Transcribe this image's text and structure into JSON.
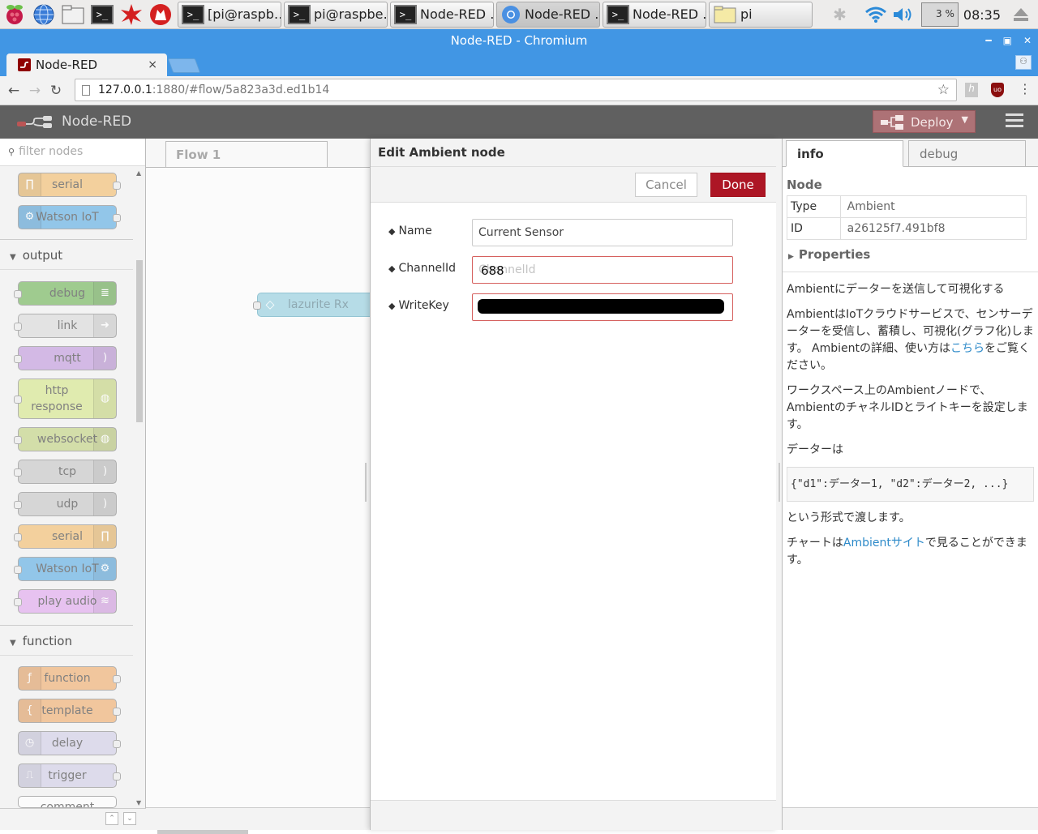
{
  "taskbar": {
    "tasks": [
      {
        "label": "[pi@raspb…"
      },
      {
        "label": "pi@raspbe…"
      },
      {
        "label": "Node-RED …"
      },
      {
        "label": "Node-RED …"
      },
      {
        "label": "Node-RED …"
      },
      {
        "label": "pi"
      }
    ],
    "cpu": "3 %",
    "clock": "08:35"
  },
  "browser": {
    "window_title": "Node-RED - Chromium",
    "tab_title": "Node-RED",
    "url_host": "127.0.0.1",
    "url_rest": ":1880/#flow/5a823a3d.ed1b14"
  },
  "header": {
    "app_name": "Node-RED",
    "deploy_label": "Deploy"
  },
  "palette": {
    "filter_placeholder": "filter nodes",
    "top_nodes": [
      "serial",
      "Watson IoT"
    ],
    "categories": [
      {
        "label": "output",
        "nodes": [
          "debug",
          "link",
          "mqtt",
          "http response",
          "websocket",
          "tcp",
          "udp",
          "serial",
          "Watson IoT",
          "play audio"
        ]
      },
      {
        "label": "function",
        "nodes": [
          "function",
          "template",
          "delay",
          "trigger",
          "comment"
        ]
      }
    ]
  },
  "workspace": {
    "flow_tab": "Flow 1",
    "node_label": "lazurite Rx"
  },
  "edit": {
    "title": "Edit Ambient node",
    "cancel": "Cancel",
    "done": "Done",
    "fields": [
      {
        "label": "Name",
        "value": "Current Sensor",
        "placeholder": ""
      },
      {
        "label": "ChannelId",
        "value": "688",
        "placeholder": "ChannelId"
      },
      {
        "label": "WriteKey",
        "value": "",
        "placeholder": ""
      }
    ]
  },
  "sidebar": {
    "tabs": [
      "info",
      "debug"
    ],
    "node_header": "Node",
    "rows": [
      {
        "key": "Type",
        "value": "Ambient"
      },
      {
        "key": "ID",
        "value": "a26125f7.491bf8"
      }
    ],
    "properties": "Properties",
    "help": {
      "p1": "Ambientにデーターを送信して可視化する",
      "p2a": "AmbientはIoTクラウドサービスで、センサーデーターを受信し、蓄積し、可視化(グラフ化)します。 Ambientの詳細、使い方は",
      "p2link": "こちら",
      "p2b": "をご覧ください。",
      "p3": "ワークスペース上のAmbientノードで、AmbientのチャネルIDとライトキーを設定します。",
      "p4": "データーは",
      "code": "{\"d1\":データー1, \"d2\":データー2, ...}",
      "p5": "という形式で渡します。",
      "p6a": "チャートは",
      "p6link": "Ambientサイト",
      "p6b": "で見ることができます。"
    }
  },
  "colors": {
    "taskbar_bg": "#edeceb",
    "chrome_blue": "#4196e4",
    "nr_header": "#606060",
    "deploy": "#ad7276",
    "done": "#ad1625",
    "error_border": "#d6615f",
    "link": "#2d8ac9"
  }
}
